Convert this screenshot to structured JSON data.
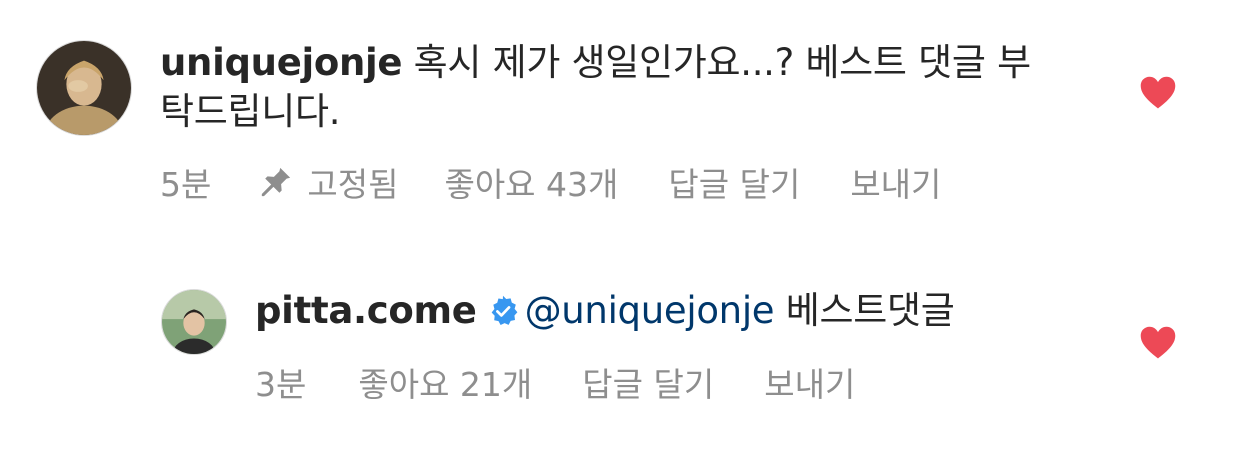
{
  "comments": [
    {
      "username": "uniquejonje",
      "text": " 혹시 제가 생일인가요...? 베스트 댓글 부",
      "text_line2": "탁드립니다.",
      "time": "5분",
      "pinned_label": "고정됨",
      "likes_label": "좋아요 43개",
      "reply_label": "답글 달기",
      "send_label": "보내기",
      "liked": true
    },
    {
      "username": "pitta.come",
      "verified": true,
      "mention": "@uniquejonje",
      "text": " 베스트댓글",
      "time": "3분",
      "likes_label": "좋아요 21개",
      "reply_label": "답글 달기",
      "send_label": "보내기",
      "liked": true
    }
  ],
  "colors": {
    "text": "#262626",
    "secondary": "#8e8e8e",
    "mention": "#00376b",
    "heart": "#ed4956",
    "verified": "#3897f0"
  }
}
